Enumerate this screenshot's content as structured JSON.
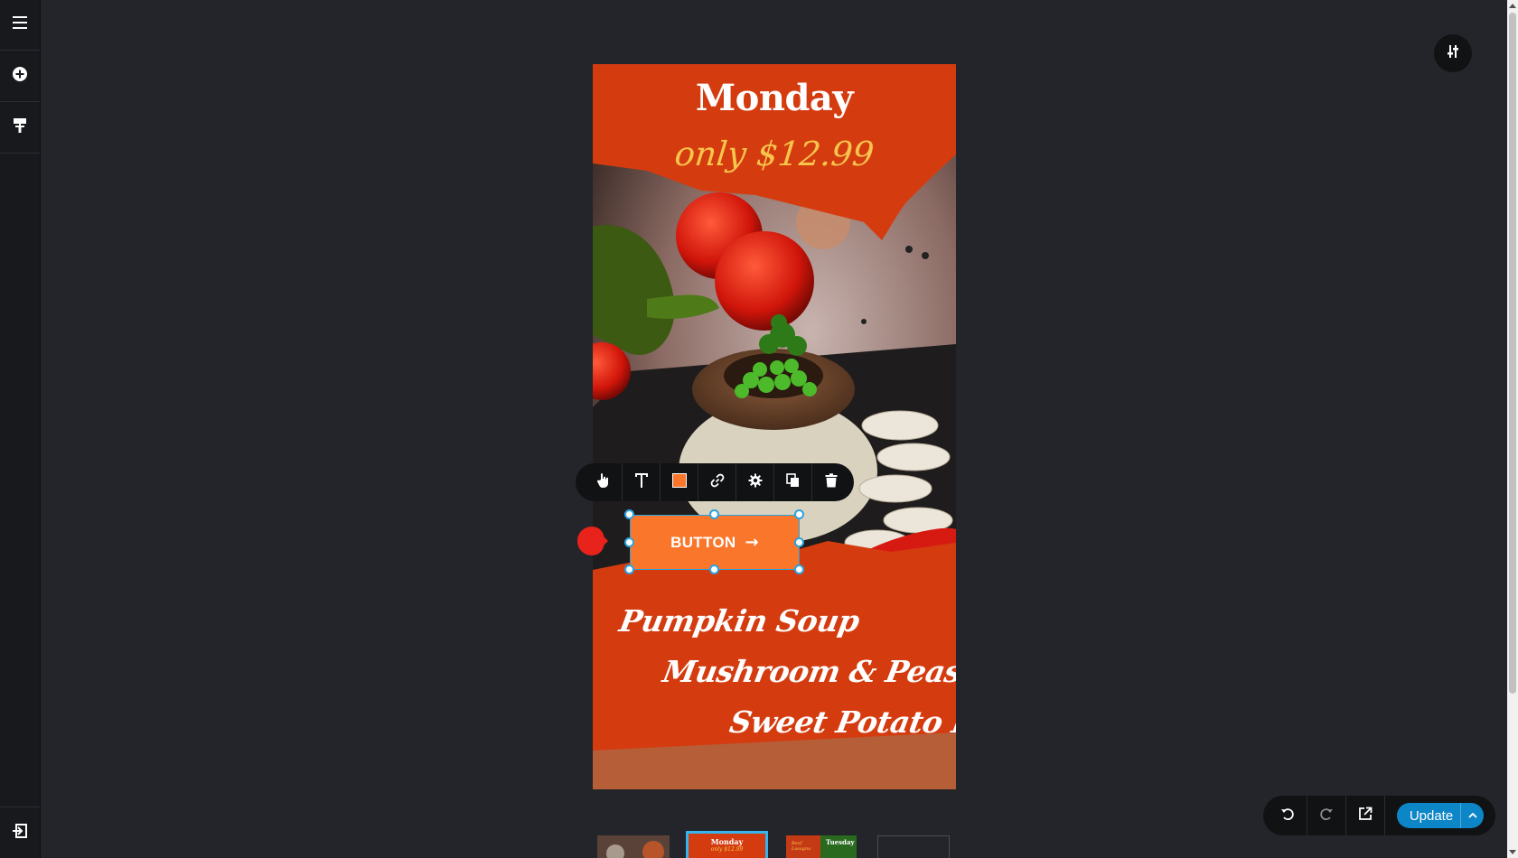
{
  "left_bar": {
    "items": [
      {
        "name": "menu-icon"
      },
      {
        "name": "add-circle-icon"
      },
      {
        "name": "paint-roller-icon"
      }
    ],
    "bottom": {
      "name": "exit-icon"
    }
  },
  "top_right": {
    "icon": "sliders-icon"
  },
  "canvas": {
    "title": "Monday",
    "price": "only $12.99",
    "menu": [
      "Pumpkin Soup",
      "Mushroom & Peas",
      "Sweet Potato Pie"
    ]
  },
  "element_toolbar": {
    "tools": [
      "hand-pointer-icon",
      "text-icon",
      "color-square-icon",
      "link-icon",
      "gear-icon",
      "copy-icon",
      "trash-icon"
    ],
    "color_swatch": "#f9762b"
  },
  "selected_button": {
    "label": "BUTTON",
    "arrow": "→",
    "bg": "#f9762b"
  },
  "action_bar": {
    "tools": [
      "undo-icon",
      "redo-icon",
      "external-link-icon"
    ],
    "update_label": "Update",
    "accent": "#0d86c8"
  },
  "thumbnails": [
    {
      "caption": ""
    },
    {
      "caption": "Monday",
      "sub": "only $12.99"
    },
    {
      "caption": "Tuesday",
      "sub": "Beef Lasagna"
    },
    {
      "caption": ""
    }
  ]
}
